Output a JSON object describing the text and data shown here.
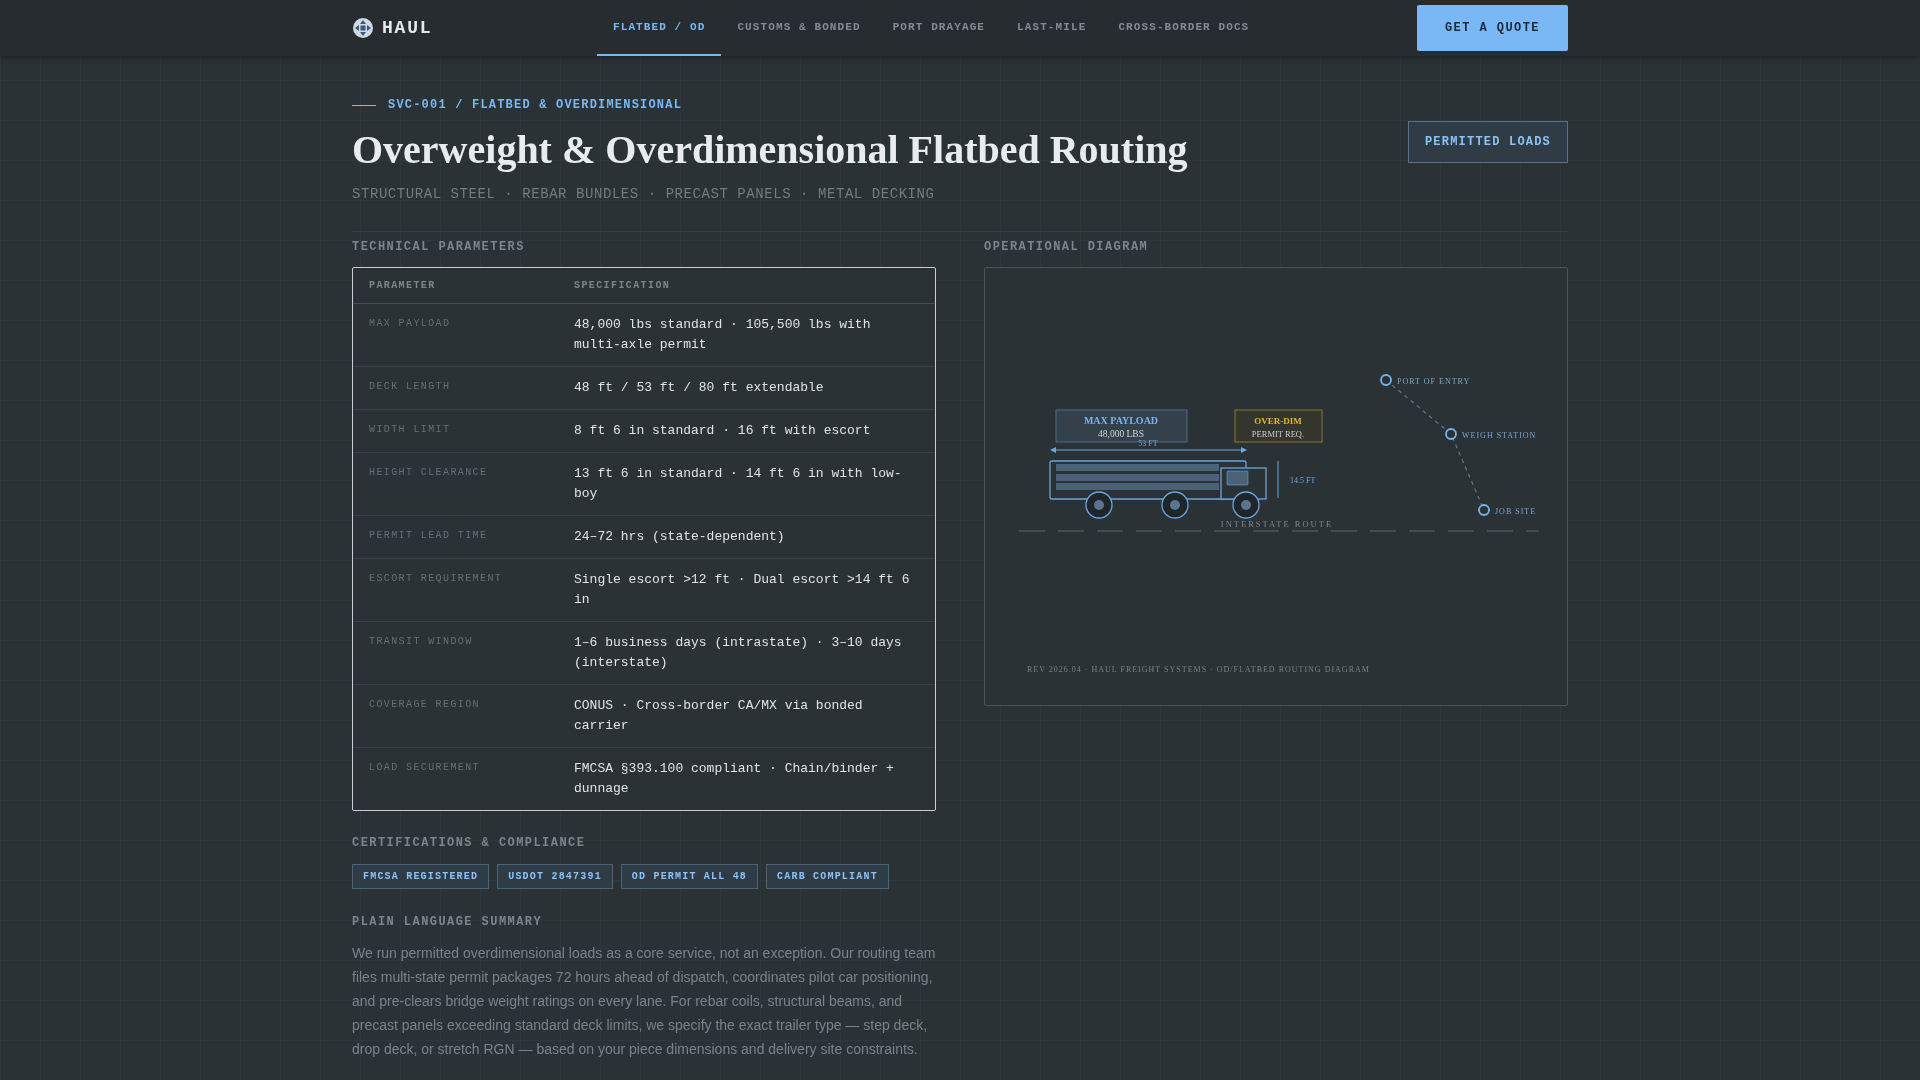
{
  "nav": {
    "brand": "HAUL",
    "tabs": [
      {
        "label": "FLATBED / OD",
        "selected": true
      },
      {
        "label": "CUSTOMS & BONDED",
        "selected": false
      },
      {
        "label": "PORT DRAYAGE",
        "selected": false
      },
      {
        "label": "LAST-MILE",
        "selected": false
      },
      {
        "label": "CROSS-BORDER DOCS",
        "selected": false
      }
    ],
    "cta": "GET A QUOTE"
  },
  "hero": {
    "breadcrumb": "SVC-001 / FLATBED & OVERDIMENSIONAL",
    "title": "Overweight & Overdimensional Flatbed Routing",
    "subtitle": "STRUCTURAL STEEL · REBAR BUNDLES · PRECAST PANELS · METAL DECKING",
    "badge": "PERMITTED LOADS"
  },
  "technical": {
    "heading": "TECHNICAL PARAMETERS",
    "columns": [
      "PARAMETER",
      "SPECIFICATION"
    ],
    "rows": [
      {
        "parameter": "MAX PAYLOAD",
        "specification": "48,000 lbs standard · 105,500 lbs with multi-axle permit"
      },
      {
        "parameter": "DECK LENGTH",
        "specification": "48 ft / 53 ft / 80 ft extendable"
      },
      {
        "parameter": "WIDTH LIMIT",
        "specification": "8 ft 6 in standard · 16 ft with escort"
      },
      {
        "parameter": "HEIGHT CLEARANCE",
        "specification": "13 ft 6 in standard · 14 ft 6 in with low-boy"
      },
      {
        "parameter": "PERMIT LEAD TIME",
        "specification": "24–72 hrs (state-dependent)"
      },
      {
        "parameter": "ESCORT REQUIREMENT",
        "specification": "Single escort >12 ft · Dual escort >14 ft 6 in"
      },
      {
        "parameter": "TRANSIT WINDOW",
        "specification": "1–6 business days (intrastate) · 3–10 days (interstate)"
      },
      {
        "parameter": "COVERAGE REGION",
        "specification": "CONUS · Cross-border CA/MX via bonded carrier"
      },
      {
        "parameter": "LOAD SECUREMENT",
        "specification": "FMCSA §393.100 compliant · Chain/binder + dunnage"
      }
    ]
  },
  "certifications": {
    "heading": "CERTIFICATIONS & COMPLIANCE",
    "tags": [
      "FMCSA REGISTERED",
      "USDOT 2847391",
      "OD PERMIT ALL 48",
      "CARB COMPLIANT"
    ]
  },
  "summary": {
    "heading": "PLAIN LANGUAGE SUMMARY",
    "text": "We run permitted overdimensional loads as a core service, not an exception. Our routing team files multi-state permit packages 72 hours ahead of dispatch, coordinates pilot car positioning, and pre-clears bridge weight ratings on every lane. For rebar coils, structural beams, and precast panels exceeding standard deck limits, we specify the exact trailer type — step deck, drop deck, or stretch RGN — based on your piece dimensions and delivery site constraints."
  },
  "diagram": {
    "heading": "OPERATIONAL DIAGRAM",
    "payload_title": "MAX PAYLOAD",
    "payload_value": "48,000 LBS",
    "overdim_title": "OVER-DIM",
    "overdim_value": "PERMIT REQ.",
    "length": "53 FT",
    "height": "14.5 FT",
    "road": "INTERSTATE ROUTE",
    "stops": [
      "PORT OF ENTRY",
      "WEIGH STATION",
      "JOB SITE"
    ],
    "footer": "REV 2026.04 · HAUL FREIGHT SYSTEMS · OD/FLATBED ROUTING DIAGRAM"
  }
}
